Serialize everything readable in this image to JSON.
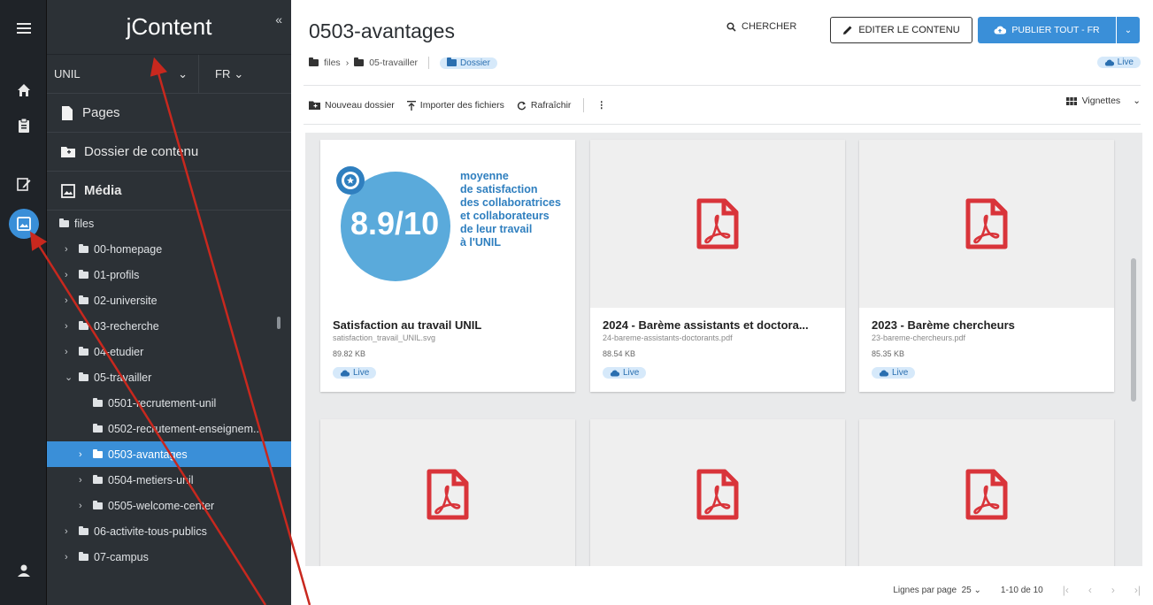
{
  "rail": {
    "icons": [
      "menu-icon",
      "home-icon",
      "clipboard-icon",
      "edit-document-icon",
      "image-icon",
      "user-icon"
    ]
  },
  "sidebar": {
    "brand": "jContent",
    "collapse": "«",
    "site": "UNIL",
    "lang": "FR",
    "sections": {
      "pages": "Pages",
      "content": "Dossier de contenu",
      "media": "Média"
    },
    "tree": {
      "root": "files",
      "items": [
        {
          "label": "00-homepage"
        },
        {
          "label": "01-profils"
        },
        {
          "label": "02-universite"
        },
        {
          "label": "03-recherche"
        },
        {
          "label": "04-etudier"
        },
        {
          "label": "05-travailler"
        },
        {
          "label": "0501-recrutement-unil"
        },
        {
          "label": "0502-recrutement-enseignem..."
        },
        {
          "label": "0503-avantages"
        },
        {
          "label": "0504-metiers-unil"
        },
        {
          "label": "0505-welcome-center"
        },
        {
          "label": "06-activite-tous-publics"
        },
        {
          "label": "07-campus"
        }
      ]
    }
  },
  "header": {
    "title": "0503-avantages",
    "crumbs": [
      "files",
      "05-travailler"
    ],
    "type_badge": "Dossier",
    "status": "Live",
    "search": "CHERCHER",
    "edit": "EDITER LE CONTENU",
    "publish": "PUBLIER TOUT - FR"
  },
  "toolbar": {
    "new_folder": "Nouveau dossier",
    "import": "Importer des fichiers",
    "refresh": "Rafraîchir",
    "view": "Vignettes"
  },
  "cards": [
    {
      "name": "Satisfaction au travail UNIL",
      "file": "satisfaction_travail_UNIL.svg",
      "size": "89.82 KB",
      "status": "Live"
    },
    {
      "name": "2024 - Barème assistants et doctora...",
      "file": "24-bareme-assistants-doctorants.pdf",
      "size": "88.54 KB",
      "status": "Live"
    },
    {
      "name": "2023 - Barème chercheurs",
      "file": "23-bareme-chercheurs.pdf",
      "size": "85.35 KB",
      "status": "Live"
    }
  ],
  "infographic": {
    "score": "8.9/10",
    "lines": [
      "moyenne",
      "de satisfaction",
      "des collaboratrices",
      "et collaborateurs",
      "de leur travail",
      "à l'UNIL"
    ]
  },
  "pager": {
    "rows_label": "Lignes par page",
    "rows_value": "25",
    "range": "1-10 de 10"
  },
  "colors": {
    "accent": "#3a8fd8",
    "sidebar": "#2c3136",
    "rail": "#1f2328",
    "pdf": "#d9343a",
    "arrow": "#c8281e"
  }
}
